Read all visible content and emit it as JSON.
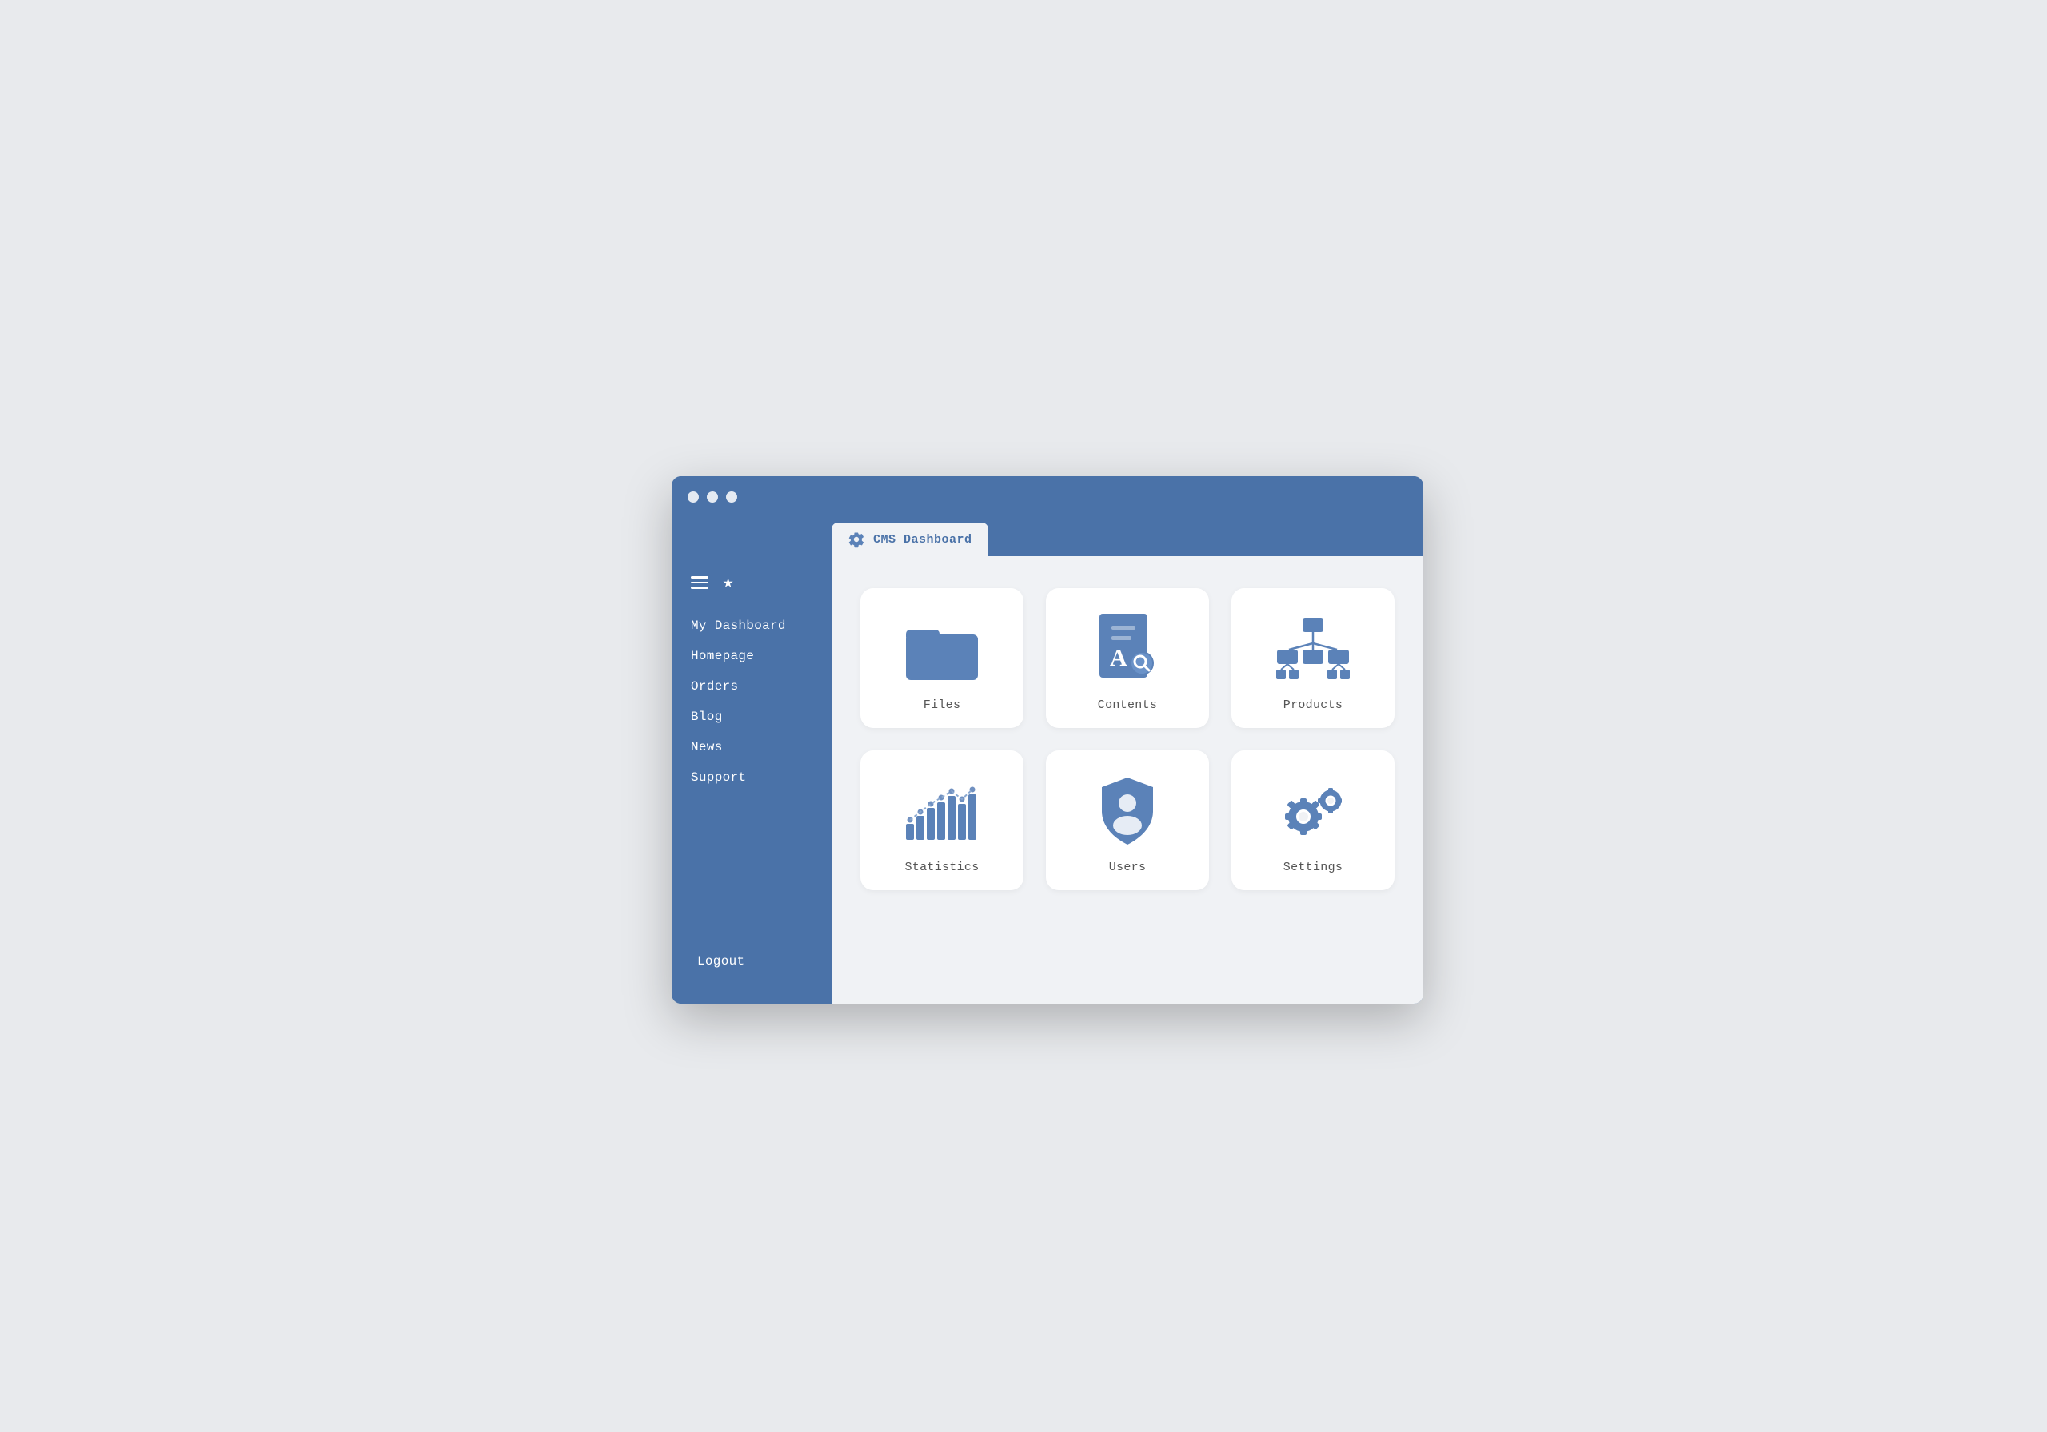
{
  "window": {
    "title": "CMS Dashboard",
    "tab_label": "CMS Dashboard"
  },
  "sidebar": {
    "nav_items": [
      {
        "label": "My Dashboard",
        "id": "my-dashboard"
      },
      {
        "label": "Homepage",
        "id": "homepage"
      },
      {
        "label": "Orders",
        "id": "orders"
      },
      {
        "label": "Blog",
        "id": "blog"
      },
      {
        "label": "News",
        "id": "news"
      },
      {
        "label": "Support",
        "id": "support"
      }
    ],
    "logout_label": "Logout"
  },
  "grid": {
    "items": [
      {
        "label": "Files",
        "id": "files",
        "icon": "folder"
      },
      {
        "label": "Contents",
        "id": "contents",
        "icon": "document"
      },
      {
        "label": "Products",
        "id": "products",
        "icon": "hierarchy"
      },
      {
        "label": "Statistics",
        "id": "statistics",
        "icon": "chart"
      },
      {
        "label": "Users",
        "id": "users",
        "icon": "shield-user"
      },
      {
        "label": "Settings",
        "id": "settings",
        "icon": "gears"
      }
    ]
  },
  "colors": {
    "primary": "#4a72a8",
    "icon": "#5b82b8",
    "bg": "#f0f2f5",
    "white": "#ffffff"
  }
}
